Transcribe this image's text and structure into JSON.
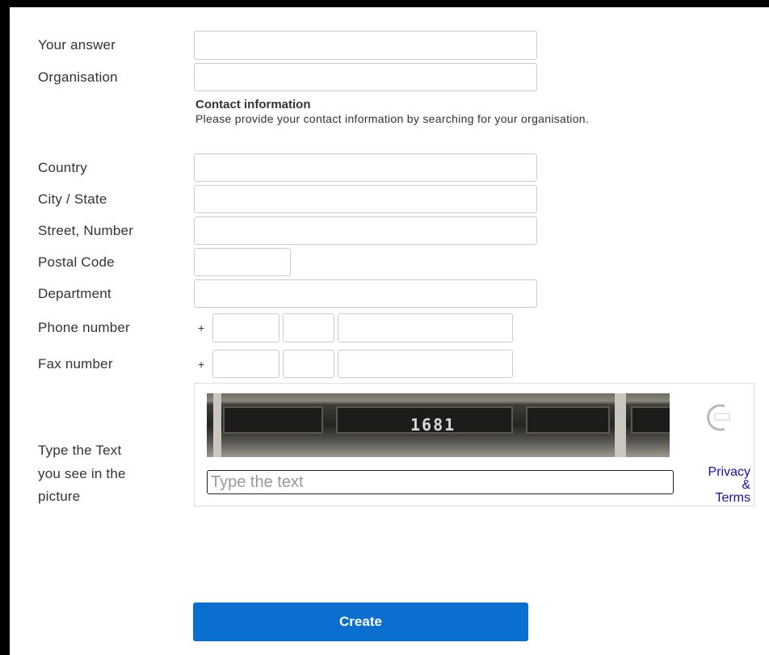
{
  "form": {
    "answer": {
      "label": "Your answer",
      "value": ""
    },
    "organisation": {
      "label": "Organisation",
      "value": ""
    },
    "contact": {
      "title": "Contact information",
      "description": "Please provide your contact information by searching for your organisation."
    },
    "country": {
      "label": "Country",
      "value": ""
    },
    "city": {
      "label": "City / State",
      "value": ""
    },
    "street": {
      "label": "Street, Number",
      "value": ""
    },
    "postal": {
      "label": "Postal Code",
      "value": ""
    },
    "department": {
      "label": "Department",
      "value": ""
    },
    "phone": {
      "label": "Phone number",
      "prefix": "+",
      "country_code": "",
      "area_code": "",
      "number": ""
    },
    "fax": {
      "label": "Fax number",
      "prefix": "+",
      "country_code": "",
      "area_code": "",
      "number": ""
    },
    "captcha": {
      "label_line1": "Type the Text",
      "label_line2": "you see in the",
      "label_line3": "picture",
      "image_text": "1681",
      "input_placeholder": "Type the text",
      "input_value": "",
      "logo_icon": "recaptcha-logo-icon",
      "privacy_line1": "Privacy",
      "privacy_line2": "&",
      "privacy_line3": "Terms"
    },
    "submit_label": "Create"
  },
  "colors": {
    "button": "#0b6fcf",
    "link": "#1a0dab",
    "border": "#cccccc"
  }
}
